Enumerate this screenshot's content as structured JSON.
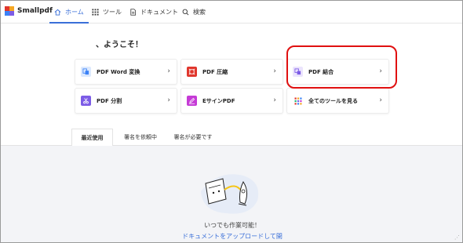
{
  "app": {
    "name": "Smallpdf"
  },
  "nav": {
    "home": "ホーム",
    "tools": "ツール",
    "documents": "ドキュメント",
    "search": "検索"
  },
  "greeting": "、ようこそ！",
  "tools": [
    {
      "label": "PDF Word 変換",
      "icon": "word-convert-icon",
      "color": "#3b82f6"
    },
    {
      "label": "PDF 圧縮",
      "icon": "compress-icon",
      "color": "#e0362c"
    },
    {
      "label": "PDF 結合",
      "icon": "merge-icon",
      "color": "#7c5ce6"
    },
    {
      "label": "PDF 分割",
      "icon": "split-icon",
      "color": "#7c5ce6"
    },
    {
      "label": "EサインPDF",
      "icon": "esign-icon",
      "color": "#c53bd6"
    },
    {
      "label": "全てのツールを見る",
      "icon": "grid-icon",
      "color": "#888888"
    }
  ],
  "chevron": "›",
  "tabs": {
    "recent": "最近使用",
    "requested": "署名を依頼中",
    "required": "署名が必要です"
  },
  "empty": {
    "title": "いつでも作業可能！",
    "link": "ドキュメントをアップロードして開"
  },
  "colors": {
    "accent": "#3a6fd8",
    "highlight": "#e01010"
  }
}
